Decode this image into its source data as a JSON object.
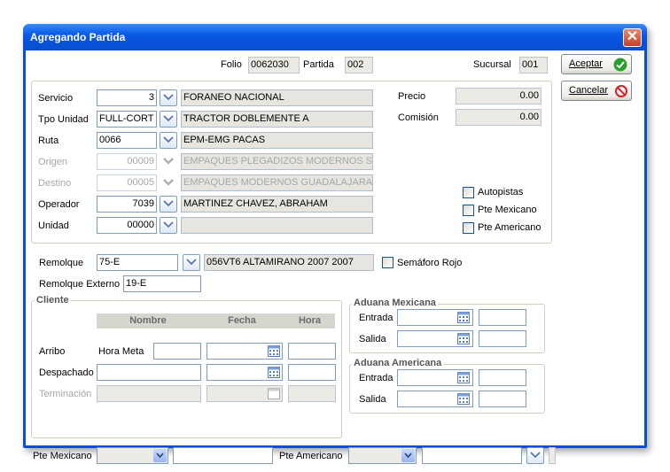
{
  "window": {
    "title": "Agregando Partida",
    "close_glyph": "✕"
  },
  "header": {
    "folio_label": "Folio",
    "folio_value": "0062030",
    "partida_label": "Partida",
    "partida_value": "002",
    "sucursal_label": "Sucursal",
    "sucursal_value": "001"
  },
  "buttons": {
    "accept_label": "Aceptar",
    "cancel_label": "Cancelar"
  },
  "main": {
    "servicio": {
      "label": "Servicio",
      "code": "3",
      "desc": "FORANEO NACIONAL"
    },
    "tpo_unidad": {
      "label": "Tpo Unidad",
      "code": "FULL-CORT",
      "desc": "TRACTOR DOBLEMENTE A"
    },
    "ruta": {
      "label": "Ruta",
      "code": "0066",
      "desc": "EPM-EMG PACAS"
    },
    "origen": {
      "label": "Origen",
      "code": "00009",
      "desc": "EMPAQUES PLEGADIZOS MODERNOS S.A. DE"
    },
    "destino": {
      "label": "Destino",
      "code": "00005",
      "desc": "EMPAQUES MODERNOS GUADALAJARA SA DE"
    },
    "operador": {
      "label": "Operador",
      "code": "7039",
      "desc": "MARTINEZ CHAVEZ, ABRAHAM"
    },
    "unidad": {
      "label": "Unidad",
      "code": "00000",
      "desc": ""
    },
    "precio": {
      "label": "Precio",
      "value": "0.00"
    },
    "comision": {
      "label": "Comisión",
      "value": "0.00"
    },
    "autopistas_label": "Autopistas",
    "pte_mexicano_label": "Pte Mexicano",
    "pte_americano_label": "Pte Americano"
  },
  "remolque": {
    "label": "Remolque",
    "code": "75-E",
    "desc": "056VT6 ALTAMIRANO 2007 2007",
    "semaforo_label": "Semáforo Rojo"
  },
  "remolque_externo": {
    "label": "Remolque Externo",
    "value": "19-E"
  },
  "cliente": {
    "title": "Cliente",
    "col_nombre": "Nombre",
    "col_fecha": "Fecha",
    "col_hora": "Hora",
    "arribo_label": "Arribo",
    "hora_meta_label": "Hora Meta",
    "despachado_label": "Despachado",
    "terminacion_label": "Terminación"
  },
  "aduana_mx": {
    "title": "Aduana Mexicana",
    "entrada_label": "Entrada",
    "salida_label": "Salida"
  },
  "aduana_us": {
    "title": "Aduana Americana",
    "entrada_label": "Entrada",
    "salida_label": "Salida"
  },
  "bottom": {
    "pte_mexicano_label": "Pte Mexicano",
    "pte_americano_label": "Pte Americano"
  }
}
